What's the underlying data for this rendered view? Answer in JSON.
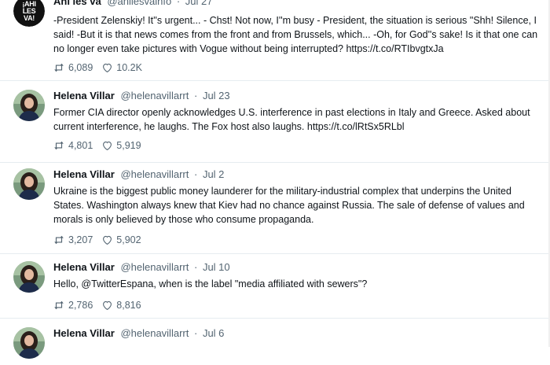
{
  "tweets": [
    {
      "name": "Ahí les va",
      "handle": "@ahilesvainfo",
      "date": "Jul 27",
      "text": "-President Zelenskiy! It''s urgent... - Chst! Not now, I''m busy - President, the situation is serious \"Shh! Silence, I said! -But it is that news comes from the front and from Brussels, which... -Oh, for God''s sake! Is it that one can no longer even take pictures with Vogue without being interrupted? https://t.co/RTIbvgtxJa",
      "retweets": "6,089",
      "likes": "10.2K",
      "avatar_logo_text": [
        "¡AHI",
        "LES",
        "VA!"
      ]
    },
    {
      "name": "Helena Villar",
      "handle": "@helenavillarrt",
      "date": "Jul 23",
      "text": "Former CIA director openly acknowledges U.S. interference in past elections in Italy and Greece. Asked about current interference, he laughs. The Fox host also laughs. https://t.co/lRtSx5RLbl",
      "retweets": "4,801",
      "likes": "5,919"
    },
    {
      "name": "Helena Villar",
      "handle": "@helenavillarrt",
      "date": "Jul 2",
      "text": "Ukraine is the biggest public money launderer for the military-industrial complex that underpins the United States. Washington always knew that Kiev had no chance against Russia. The sale of defense of values and morals is only believed by those who consume propaganda.",
      "retweets": "3,207",
      "likes": "5,902"
    },
    {
      "name": "Helena Villar",
      "handle": "@helenavillarrt",
      "date": "Jul 10",
      "text": "Hello, @TwitterEspana, when is the label \"media affiliated with sewers\"?",
      "retweets": "2,786",
      "likes": "8,816"
    },
    {
      "name": "Helena Villar",
      "handle": "@helenavillarrt",
      "date": "Jul 6",
      "text": "",
      "retweets": "",
      "likes": ""
    }
  ],
  "icons": {
    "retweet": "retweet-icon",
    "like": "heart-icon"
  },
  "colors": {
    "secondary_text": "#536471",
    "divider": "#e6ecf0"
  }
}
